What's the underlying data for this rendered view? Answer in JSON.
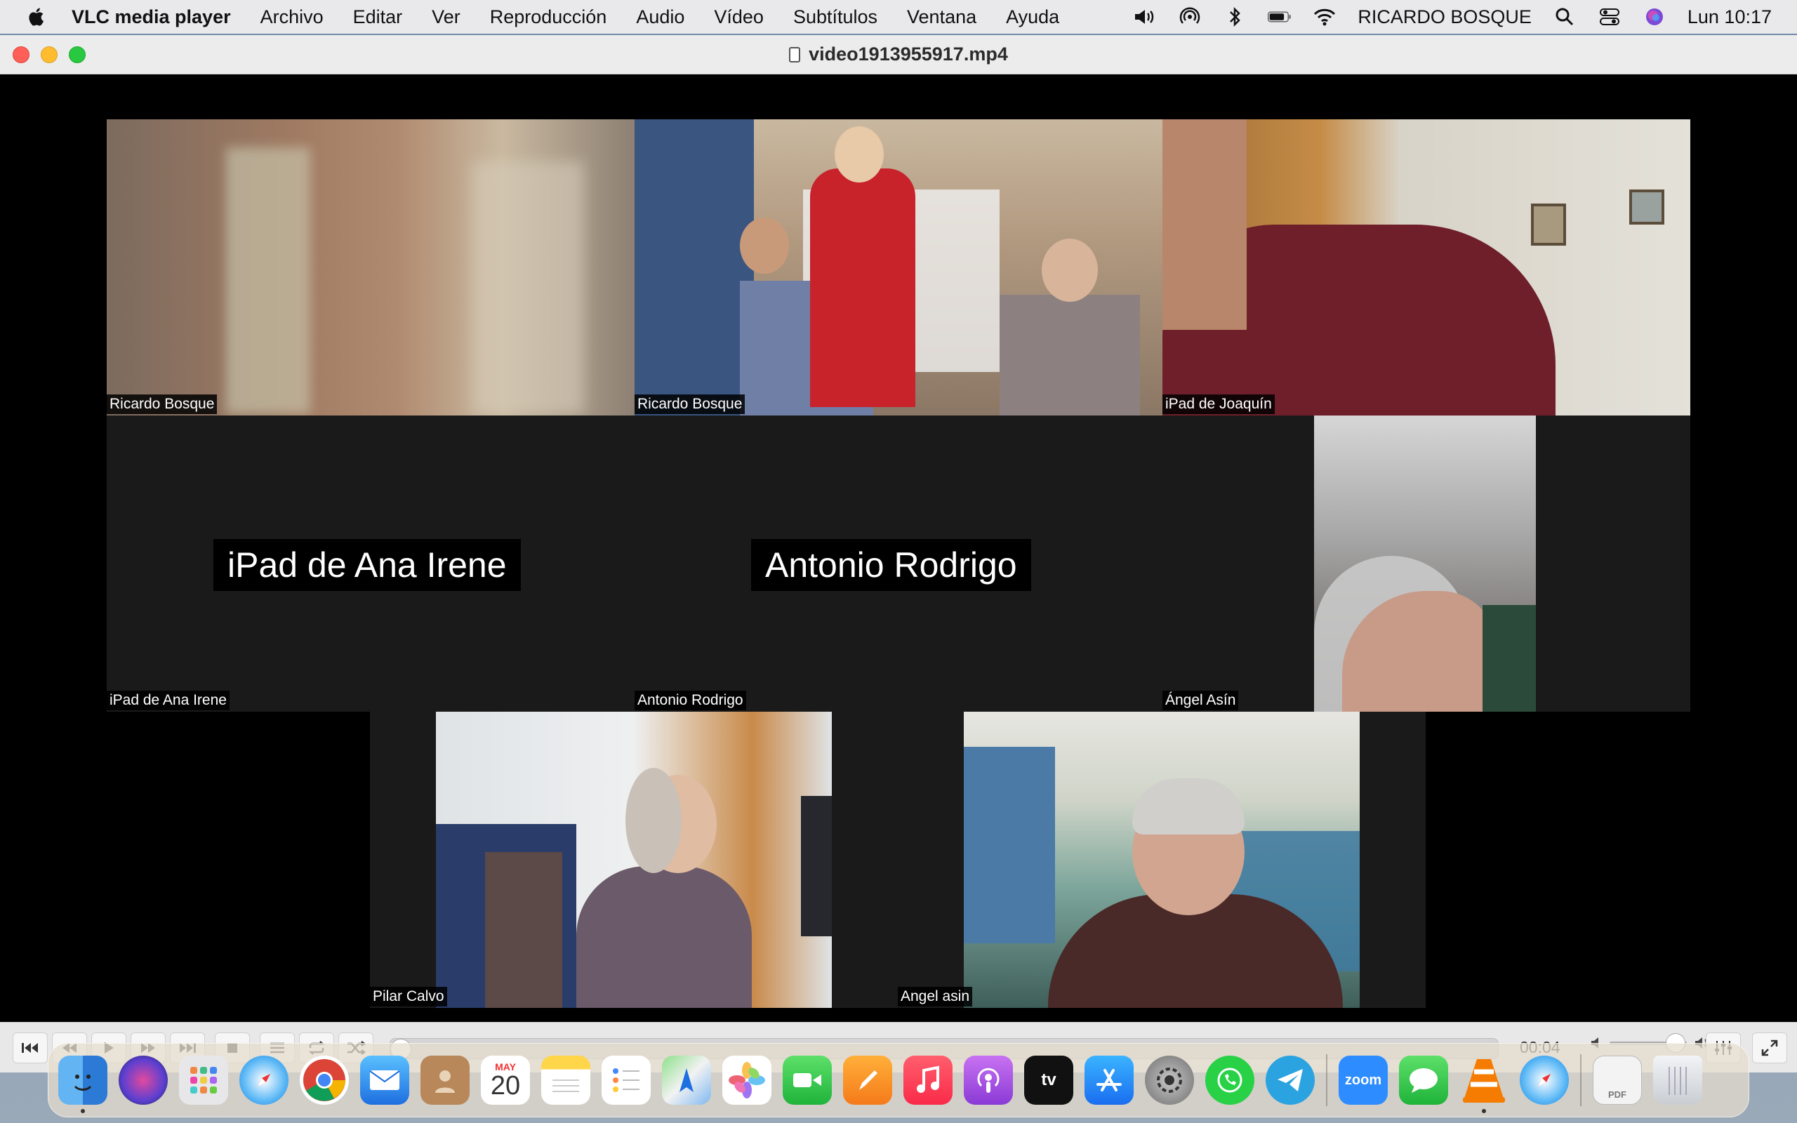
{
  "menubar": {
    "app_name": "VLC media player",
    "menus": [
      "Archivo",
      "Editar",
      "Ver",
      "Reproducción",
      "Audio",
      "Vídeo",
      "Subtítulos",
      "Ventana",
      "Ayuda"
    ],
    "user": "RICARDO BOSQUE",
    "clock": "Lun 10:17"
  },
  "window": {
    "title": "video1913955917.mp4"
  },
  "participants": {
    "t1": "Ricardo Bosque",
    "t2": "Ricardo Bosque",
    "t3": "iPad de Joaquín",
    "t4": "iPad de Ana Irene",
    "t4_big": "iPad de Ana Irene",
    "t5": "Antonio Rodrigo",
    "t5_big": "Antonio Rodrigo",
    "t6": "Ángel Asín",
    "t7": "Pilar Calvo",
    "t8": "Angel asin"
  },
  "controls": {
    "time": "00:04",
    "progress": 0.0,
    "volume": 0.85
  },
  "dock": {
    "calendar_month": "MAY",
    "calendar_day": "20",
    "zoom_label": "zoom",
    "tv_label": "tv",
    "pdf_label": "PDF"
  },
  "colors": {
    "zoom_tile_bg": "#1a1a1a",
    "menubar_bg": "#e9e9ec"
  }
}
